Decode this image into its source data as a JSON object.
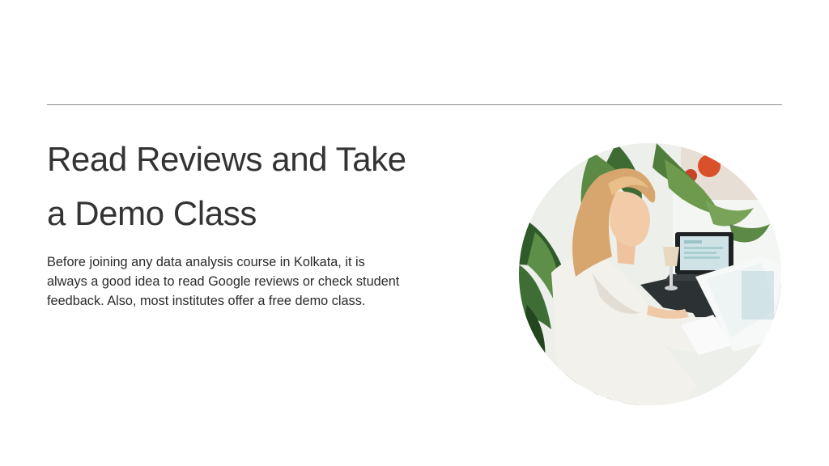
{
  "slide": {
    "title": "Read Reviews and Take a Demo Class",
    "body": "Before joining any data analysis course in Kolkata, it is always a good idea to read Google reviews or check student feedback. Also, most institutes offer a free demo class."
  },
  "photo": {
    "subject": "woman-reviewing-documents-at-laptop"
  },
  "colors": {
    "heading": "#333333",
    "body": "#2b2b2b",
    "divider": "#8a8a8a",
    "background": "#ffffff"
  }
}
